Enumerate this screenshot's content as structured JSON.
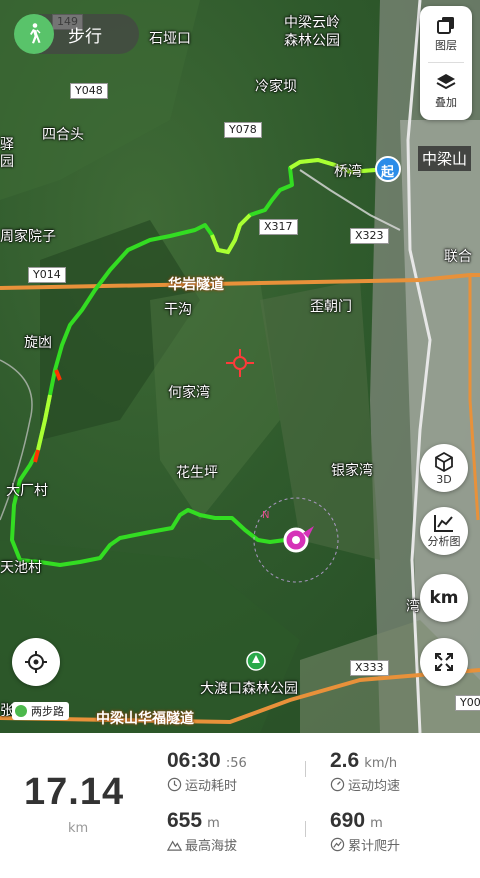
{
  "mode": {
    "label": "步行"
  },
  "map": {
    "places": [
      {
        "id": "shiyakou",
        "text": "石垭口"
      },
      {
        "id": "zhongliang_park_1",
        "text": "中梁云岭"
      },
      {
        "id": "zhongliang_park_2",
        "text": "森林公园"
      },
      {
        "id": "lengjiaba",
        "text": "冷家坝"
      },
      {
        "id": "sihetou",
        "text": "四合头"
      },
      {
        "id": "yi",
        "text": "驿"
      },
      {
        "id": "yuan",
        "text": "园"
      },
      {
        "id": "zhoujiayuanzi",
        "text": "周家院子"
      },
      {
        "id": "qiaowan",
        "text": "桥湾"
      },
      {
        "id": "zhongliangshan",
        "text": "中梁山"
      },
      {
        "id": "lianhe",
        "text": "联合"
      },
      {
        "id": "gangou",
        "text": "干沟"
      },
      {
        "id": "waichaomen",
        "text": "歪朝门"
      },
      {
        "id": "xuanhan",
        "text": "旋凼"
      },
      {
        "id": "hejiawan",
        "text": "何家湾"
      },
      {
        "id": "huashengping",
        "text": "花生坪"
      },
      {
        "id": "yinjiawan",
        "text": "银家湾"
      },
      {
        "id": "dachangcun",
        "text": "大厂村"
      },
      {
        "id": "tianchicun",
        "text": "天池村"
      },
      {
        "id": "wan",
        "text": "湾"
      },
      {
        "id": "dadukou",
        "text": "大渡口森林公园"
      },
      {
        "id": "zhang",
        "text": "张"
      }
    ],
    "roads": [
      {
        "id": "y149",
        "text": "149"
      },
      {
        "id": "y048",
        "text": "Y048"
      },
      {
        "id": "y078",
        "text": "Y078"
      },
      {
        "id": "x317",
        "text": "X317"
      },
      {
        "id": "x323",
        "text": "X323"
      },
      {
        "id": "y014",
        "text": "Y014"
      },
      {
        "id": "x333",
        "text": "X333"
      },
      {
        "id": "y00",
        "text": "Y00"
      }
    ],
    "tunnels": [
      {
        "id": "huayan",
        "text": "华岩隧道"
      },
      {
        "id": "huafu",
        "text": "中梁山华福隧道"
      }
    ],
    "start_marker": "起",
    "route_badge": "两步路"
  },
  "controls": {
    "layers_label": "图层",
    "overlay_label": "叠加",
    "threed_label": "3D",
    "analysis_label": "分析图",
    "km_label": "km",
    "icons": [
      "layers-icon",
      "overlay-icon",
      "cube-icon",
      "chart-icon",
      "locate-icon",
      "expand-icon"
    ]
  },
  "stats": {
    "distance": "17.14",
    "distance_unit": "km",
    "duration_main": "06:30",
    "duration_sec": ":56",
    "duration_label": "运动耗时",
    "avg_speed": "2.6",
    "avg_speed_unit": "km/h",
    "avg_speed_label": "运动均速",
    "max_alt": "655",
    "max_alt_unit": "m",
    "max_alt_label": "最高海拔",
    "climb": "690",
    "climb_unit": "m",
    "climb_label": "累计爬升"
  },
  "colors": {
    "route_main": "#33dd22",
    "route_fast": "#aaff33",
    "route_slow": "#ff3300",
    "road": "#e8913a",
    "mode_green": "#59c36a",
    "start_blue": "#2b8ce8",
    "position": "#d631b8"
  }
}
